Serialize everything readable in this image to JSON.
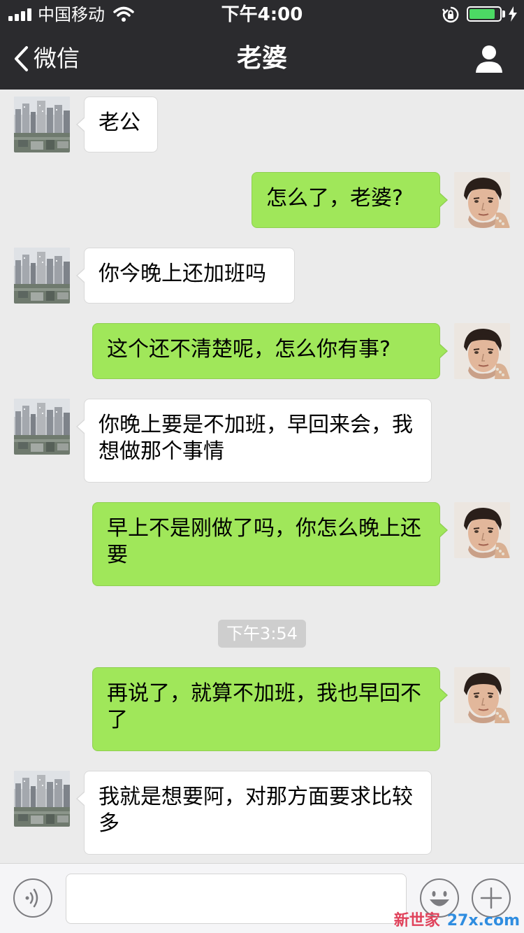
{
  "status_bar": {
    "carrier": "中国移动",
    "time": "下午4:00",
    "battery_level": 0.85
  },
  "nav": {
    "back_label": "微信",
    "title": "老婆"
  },
  "messages": [
    {
      "side": "left",
      "text": "老公"
    },
    {
      "side": "right",
      "text": "怎么了，老婆?"
    },
    {
      "side": "left",
      "text": "你今晚上还加班吗"
    },
    {
      "side": "right",
      "text": "这个还不清楚呢，怎么你有事?"
    },
    {
      "side": "left",
      "text": "你晚上要是不加班，早回来会，我想做那个事情"
    },
    {
      "side": "right",
      "text": "早上不是刚做了吗，你怎么晚上还要"
    },
    {
      "side": "right",
      "text": "再说了，就算不加班，我也早回不了"
    },
    {
      "side": "left",
      "text": "我就是想要阿，对那方面要求比较多"
    }
  ],
  "time_divider": "下午3:54",
  "input": {
    "value": "",
    "placeholder": ""
  },
  "watermark": {
    "cn": "新世家",
    "en": "27x.com"
  },
  "colors": {
    "header_bg": "#2b2b2e",
    "chat_bg": "#ebebeb",
    "sent_bubble": "#a0e75a",
    "received_bubble": "#ffffff",
    "battery": "#4cd964"
  }
}
